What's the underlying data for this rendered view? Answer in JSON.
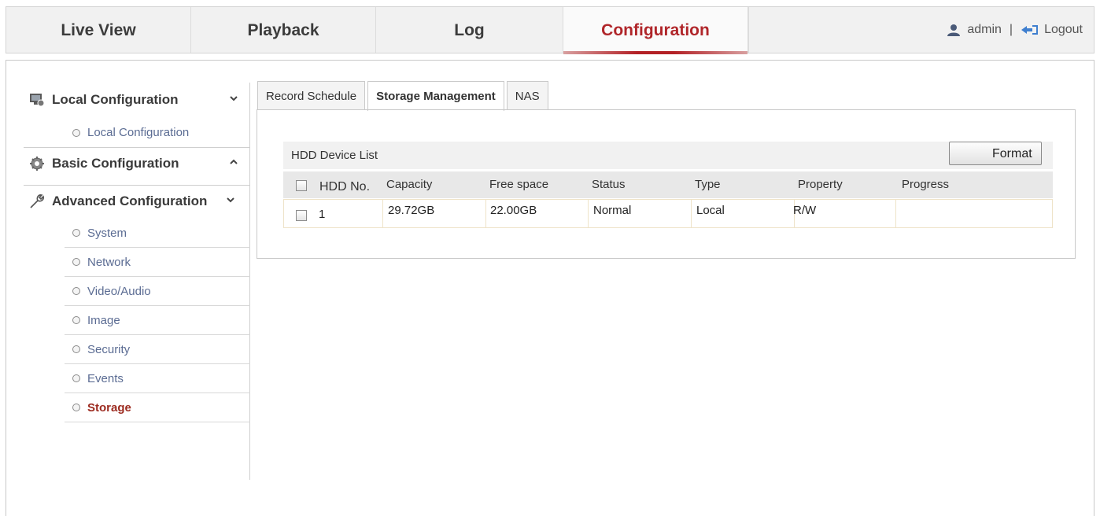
{
  "nav": {
    "tabs": [
      {
        "label": "Live View"
      },
      {
        "label": "Playback"
      },
      {
        "label": "Log"
      },
      {
        "label": "Configuration"
      }
    ],
    "user": "admin",
    "separator": "|",
    "logout": "Logout",
    "active_color": "#b0262a"
  },
  "sidebar": {
    "groups": [
      {
        "label": "Local Configuration",
        "icon": "monitor-gear-icon"
      },
      {
        "label": "Basic Configuration",
        "icon": "gear-icon"
      },
      {
        "label": "Advanced Configuration",
        "icon": "wrench-icon"
      }
    ],
    "local_items": [
      "Local Configuration"
    ],
    "advanced_items": [
      "System",
      "Network",
      "Video/Audio",
      "Image",
      "Security",
      "Events",
      "Storage"
    ]
  },
  "content": {
    "tabs": [
      "Record Schedule",
      "Storage Management",
      "NAS"
    ],
    "list_title": "HDD Device List",
    "format_label": "Format",
    "columns": [
      "HDD No.",
      "Capacity",
      "Free space",
      "Status",
      "Type",
      "Property",
      "Progress"
    ],
    "rows": [
      {
        "hdd_no": "1",
        "capacity": "29.72GB",
        "free_space": "22.00GB",
        "status": "Normal",
        "type": "Local",
        "property": "R/W",
        "progress": ""
      }
    ]
  }
}
